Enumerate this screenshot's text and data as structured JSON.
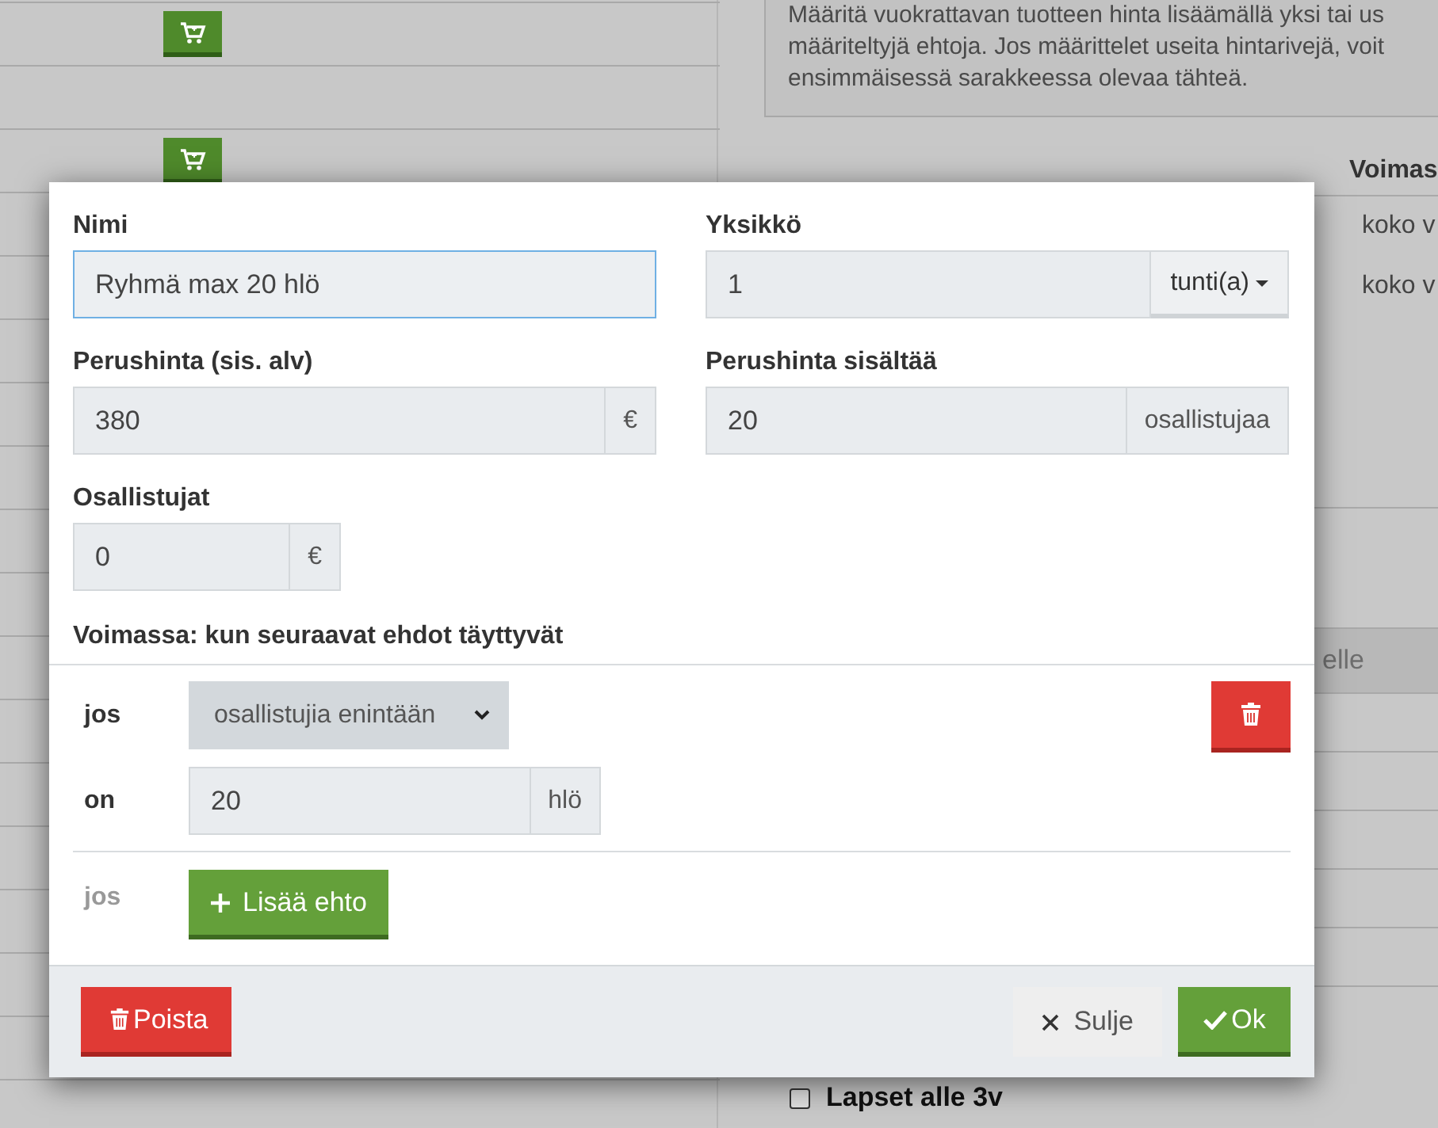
{
  "background": {
    "info_lines": [
      "Määritä vuokrattavan tuotteen hinta lisäämällä yksi tai us",
      "määriteltyjä ehtoja. Jos määrittelet useita hintarivejä, voit",
      "ensimmäisessä sarakkeessa olevaa tähteä."
    ],
    "table_header": "Voimas",
    "table_cells": [
      "koko v",
      "koko v"
    ],
    "band_text": "elle",
    "checkbox": {
      "label": "Lapset alle 3v",
      "checked": false
    }
  },
  "dialog": {
    "fields": [
      {
        "label": "Nimi",
        "value": "Ryhmä max 20 hlö",
        "focused": true
      },
      {
        "label": "Yksikkö",
        "value": "1",
        "focused": false,
        "addon": {
          "kind": "dropdown",
          "label": "tunti(a)"
        }
      },
      {
        "label": "Perushinta (sis. alv)",
        "value": "380",
        "focused": false,
        "addon": {
          "kind": "text",
          "label": "€"
        }
      },
      {
        "label": "Perushinta sisältää",
        "value": "20",
        "focused": false,
        "addon": {
          "kind": "text",
          "label": "osallistujaa"
        }
      },
      {
        "label": "Osallistujat",
        "value": "0",
        "focused": false,
        "addon": {
          "kind": "text",
          "label": "€"
        }
      }
    ],
    "section_title": "Voimassa: kun seuraavat ehdot täyttyvät",
    "conditions": [
      {
        "rows": [
          {
            "label": "jos",
            "kind": "select",
            "value": "osallistujia enintään"
          },
          {
            "label": "on",
            "kind": "input",
            "value": "20",
            "addon": "hlö"
          }
        ]
      }
    ],
    "add_row": {
      "label": "jos",
      "button": "Lisää ehto"
    },
    "footer": {
      "delete": "Poista",
      "close": "Sulje",
      "ok": "Ok"
    }
  }
}
